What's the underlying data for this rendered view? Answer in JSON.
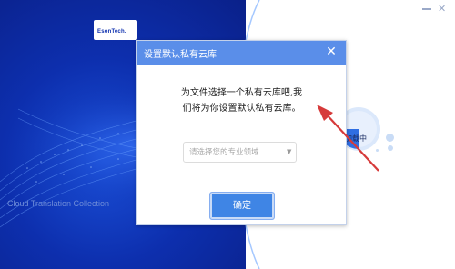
{
  "background": {
    "logo_text": "EsonTech.",
    "tagline": "Cloud Translation Collection",
    "loading_label": "加载中",
    "colors": {
      "left_panel": "#0d2fae",
      "accent": "#2f6ee2"
    }
  },
  "window": {
    "close_glyph": "✕",
    "minimize_icon": "minimize-icon"
  },
  "dialog": {
    "title": "设置默认私有云库",
    "close_glyph": "✕",
    "message_line1": "为文件选择一个私有云库吧,我",
    "message_line2": "们将为你设置默认私有云库。",
    "select": {
      "placeholder": "请选择您的专业领域",
      "caret": "▼"
    },
    "ok_label": "确定",
    "colors": {
      "header": "#5a8ee9",
      "button": "#3f85e5"
    }
  },
  "annotation": {
    "arrow_color": "#d63a3a"
  }
}
